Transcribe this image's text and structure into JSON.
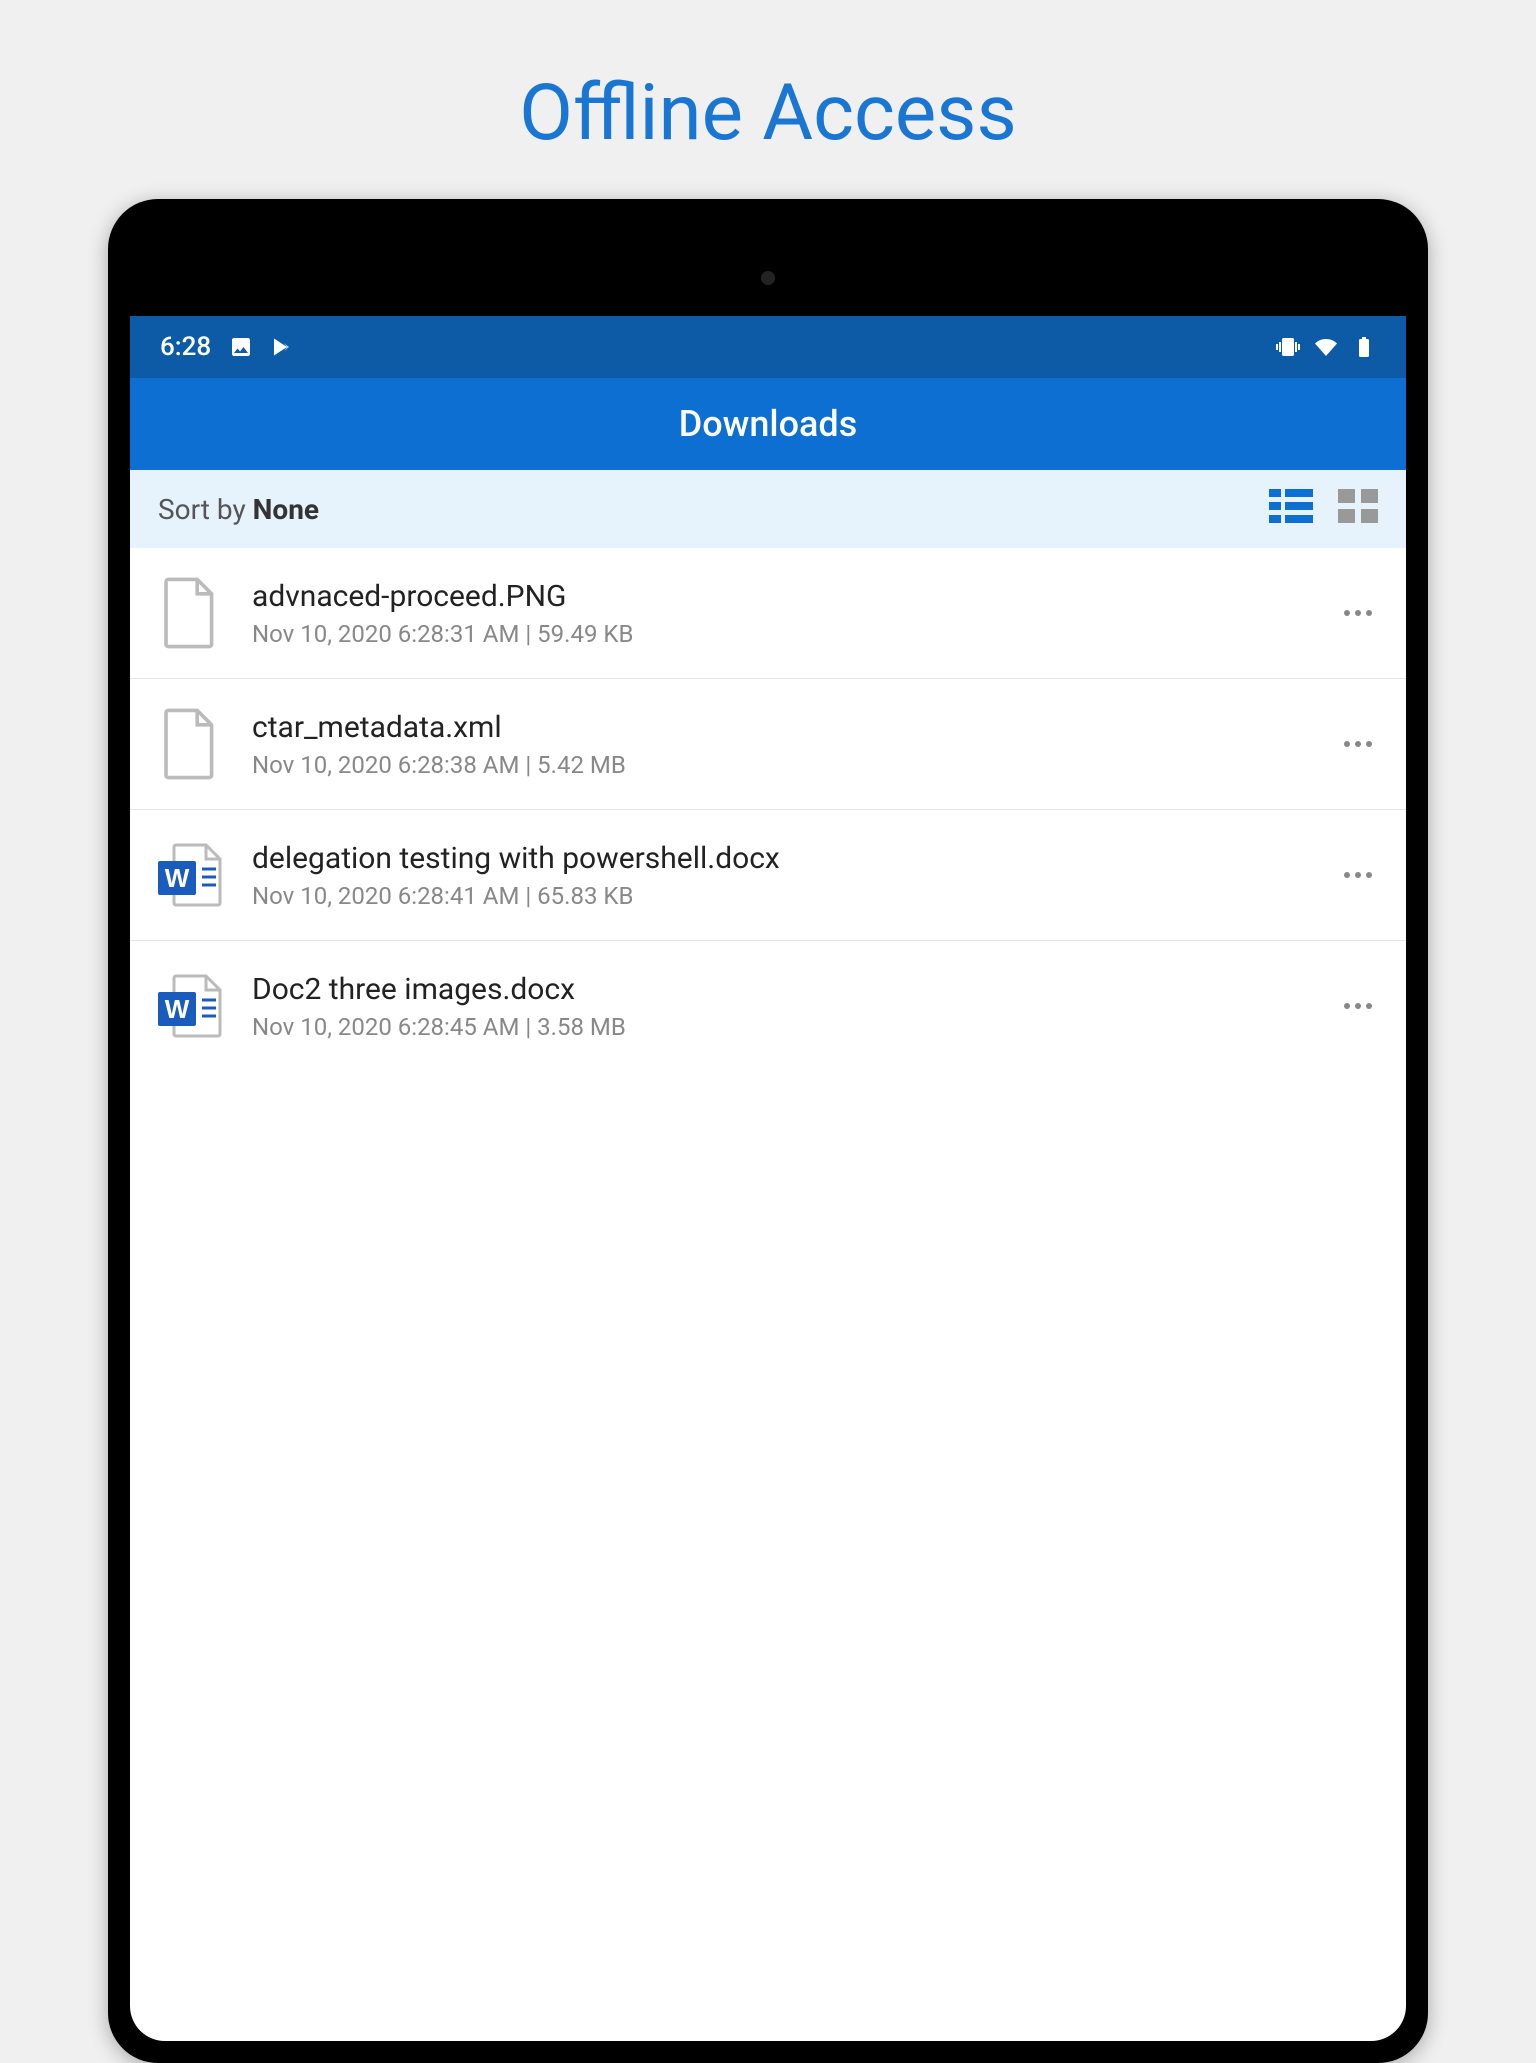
{
  "page_title": "Offline Access",
  "status_bar": {
    "time": "6:28"
  },
  "app_bar": {
    "title": "Downloads"
  },
  "sort_bar": {
    "prefix": "Sort by ",
    "value": "None"
  },
  "files": [
    {
      "name": "advnaced-proceed.PNG",
      "meta": "Nov 10, 2020 6:28:31 AM | 59.49 KB",
      "type": "generic"
    },
    {
      "name": "ctar_metadata.xml",
      "meta": "Nov 10, 2020 6:28:38 AM | 5.42 MB",
      "type": "generic"
    },
    {
      "name": "delegation testing with powershell.docx",
      "meta": "Nov 10, 2020 6:28:41 AM | 65.83 KB",
      "type": "word"
    },
    {
      "name": "Doc2 three images.docx",
      "meta": "Nov 10, 2020 6:28:45 AM | 3.58 MB",
      "type": "word"
    }
  ]
}
